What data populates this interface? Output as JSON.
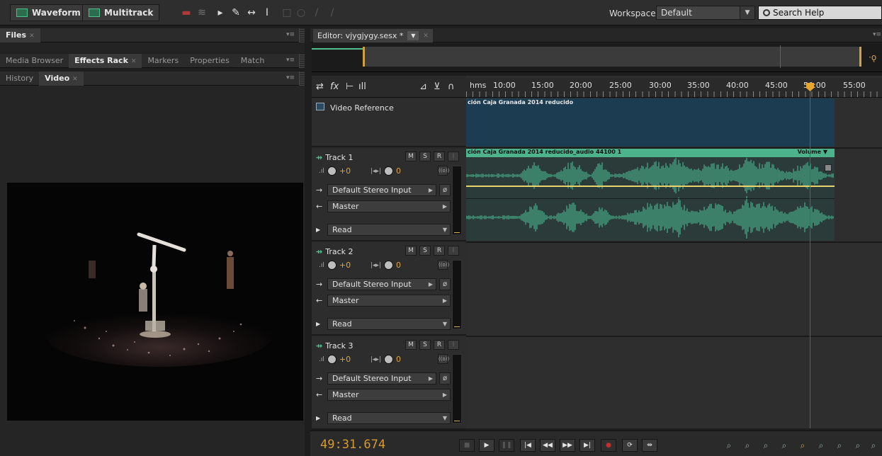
{
  "toolbar": {
    "waveform_label": "Waveform",
    "multitrack_label": "Multitrack",
    "workspace_label": "Workspace:",
    "workspace_value": "Default",
    "search_placeholder": "Search Help"
  },
  "panels": {
    "top_tabs": [
      "Files"
    ],
    "middle_tabs": [
      "Media Browser",
      "Effects Rack",
      "Markers",
      "Properties",
      "Match"
    ],
    "bottom_tabs": [
      "History",
      "Video"
    ]
  },
  "editor": {
    "tab_label": "Editor: vjygjygy.sesx *",
    "ruler_labels": [
      "hms",
      "10:00",
      "15:00",
      "20:00",
      "25:00",
      "30:00",
      "35:00",
      "40:00",
      "45:00",
      "50:00",
      "55:00"
    ],
    "video_reference_label": "Video Reference",
    "video_clip_label": "ción Caja Granada 2014 reducido",
    "audio_clip_label": "ción Caja Granada 2014 reducido_audio 44100 1",
    "audio_clip_envelope": "Volume"
  },
  "tracks": [
    {
      "name": "Track 1",
      "volume": "+0",
      "pan": "0",
      "input": "Default Stereo Input",
      "output": "Master",
      "automation": "Read"
    },
    {
      "name": "Track 2",
      "volume": "+0",
      "pan": "0",
      "input": "Default Stereo Input",
      "output": "Master",
      "automation": "Read"
    },
    {
      "name": "Track 3",
      "volume": "+0",
      "pan": "0",
      "input": "Default Stereo Input",
      "output": "Master",
      "automation": "Read"
    }
  ],
  "track_buttons": {
    "mute": "M",
    "solo": "S",
    "record": "R",
    "input_monitor": "I"
  },
  "transport": {
    "time": "49:31.674"
  },
  "colors": {
    "accent": "#4db38c",
    "time": "#d79a2e",
    "playhead": "#d43030",
    "video_clip": "#1c3c52"
  }
}
